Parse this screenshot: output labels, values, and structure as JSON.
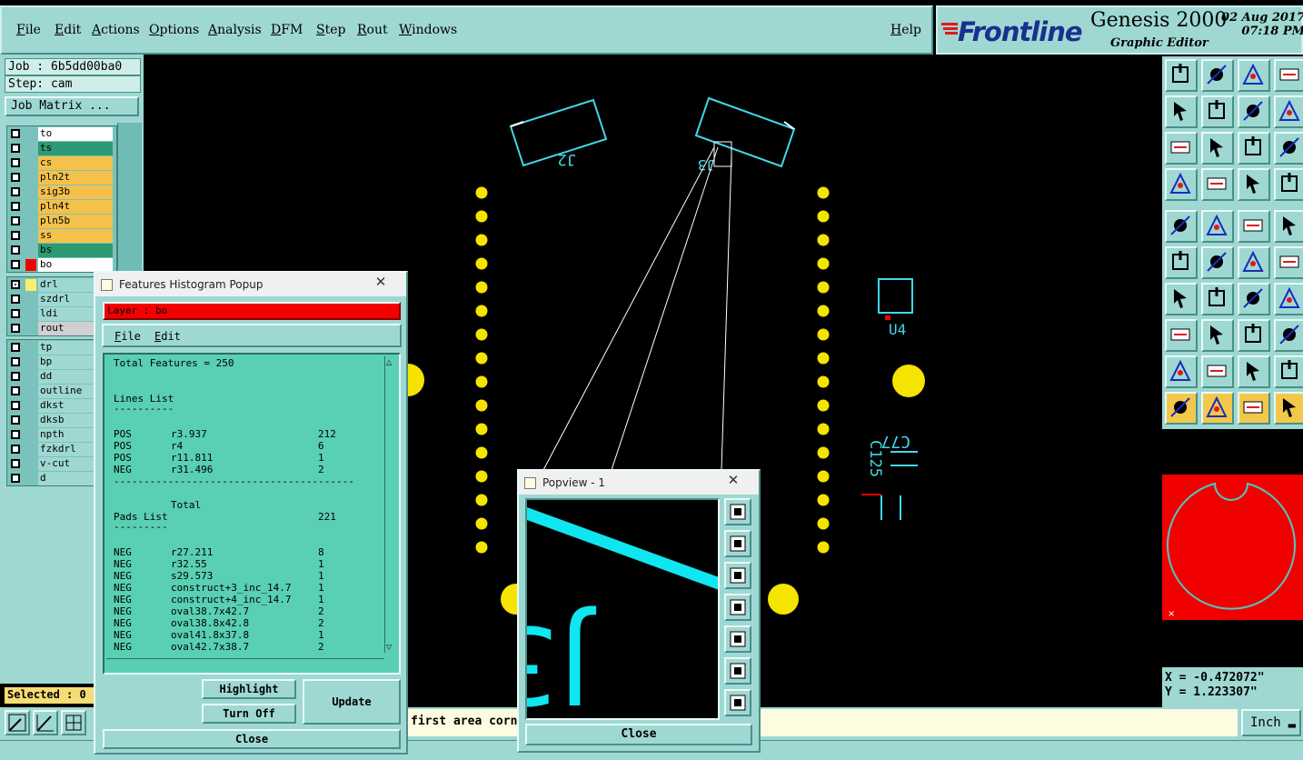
{
  "menu": {
    "items": [
      "File",
      "Edit",
      "Actions",
      "Options",
      "Analysis",
      "DFM",
      "Step",
      "Rout",
      "Windows"
    ],
    "help": "Help"
  },
  "brand": {
    "logo": "Frontline",
    "product": "Genesis 2000",
    "subtitle": "Graphic Editor",
    "date": "02 Aug 2017",
    "time": "07:18 PM"
  },
  "job": {
    "job": "Job : 6b5dd00ba0",
    "step": "Step: cam",
    "matrix_button": "Job Matrix ..."
  },
  "layers_group1": [
    {
      "name": "to",
      "color": "#ffffff"
    },
    {
      "name": "ts",
      "color": "#2c9a73"
    },
    {
      "name": "cs",
      "color": "#f4c24a"
    },
    {
      "name": "pln2t",
      "color": "#f4c24a"
    },
    {
      "name": "sig3b",
      "color": "#f4c24a"
    },
    {
      "name": "pln4t",
      "color": "#f4c24a"
    },
    {
      "name": "pln5b",
      "color": "#f4c24a"
    },
    {
      "name": "ss",
      "color": "#f4c24a"
    },
    {
      "name": "bs",
      "color": "#2c9a73"
    },
    {
      "name": "bo",
      "color": "#ffffff",
      "swatch": "#f20000"
    }
  ],
  "layers_group2": [
    {
      "name": "drl",
      "color": "#9fd8d3",
      "swatch": "#f9f06a",
      "on": true
    },
    {
      "name": "szdrl",
      "color": "#9fd8d3"
    },
    {
      "name": "ldi",
      "color": "#9fd8d3"
    },
    {
      "name": "rout",
      "color": "#d0d0d0"
    }
  ],
  "layers_group3": [
    {
      "name": "tp",
      "color": "#9fd8d3"
    },
    {
      "name": "bp",
      "color": "#9fd8d3"
    },
    {
      "name": "dd",
      "color": "#9fd8d3"
    },
    {
      "name": "outline",
      "color": "#9fd8d3"
    },
    {
      "name": "dkst",
      "color": "#9fd8d3"
    },
    {
      "name": "dksb",
      "color": "#9fd8d3"
    },
    {
      "name": "npth",
      "color": "#9fd8d3"
    },
    {
      "name": "fzkdrl",
      "color": "#9fd8d3"
    },
    {
      "name": "v-cut",
      "color": "#9fd8d3"
    },
    {
      "name": "d",
      "color": "#9fd8d3"
    }
  ],
  "selected": "Selected : 0",
  "prompt": "first area corner",
  "unit": "Inch",
  "status_text": "",
  "coords": {
    "x": "X = -0.472072\"",
    "y": "Y = 1.223307\""
  },
  "board_labels": {
    "j2": "J2",
    "j3": "J3",
    "u4": "U4",
    "c77": "C77",
    "c125": "C125"
  },
  "histogram": {
    "title": "Features Histogram Popup",
    "layer": "Layer :  bo",
    "menu_file": "File",
    "menu_edit": "Edit",
    "total": "Total Features = 250",
    "lines_heading": "Lines List",
    "lines_rule": "----------",
    "lines": [
      {
        "pol": "POS",
        "sym": "r3.937",
        "count": "212"
      },
      {
        "pol": "POS",
        "sym": "r4",
        "count": "6"
      },
      {
        "pol": "POS",
        "sym": "r11.811",
        "count": "1"
      },
      {
        "pol": "NEG",
        "sym": "r31.496",
        "count": "2"
      }
    ],
    "divider": "----------------------------------------",
    "total_label": "Total",
    "total_value": "221",
    "pads_heading": "Pads List",
    "pads_rule": "---------",
    "pads": [
      {
        "pol": "NEG",
        "sym": "r27.211",
        "count": "8"
      },
      {
        "pol": "NEG",
        "sym": "r32.55",
        "count": "1"
      },
      {
        "pol": "NEG",
        "sym": "s29.573",
        "count": "1"
      },
      {
        "pol": "NEG",
        "sym": "construct+3_inc_14.7",
        "count": "1"
      },
      {
        "pol": "NEG",
        "sym": "construct+4_inc_14.7",
        "count": "1"
      },
      {
        "pol": "NEG",
        "sym": "oval38.7x42.7",
        "count": "2"
      },
      {
        "pol": "NEG",
        "sym": "oval38.8x42.8",
        "count": "2"
      },
      {
        "pol": "NEG",
        "sym": "oval41.8x37.8",
        "count": "1"
      },
      {
        "pol": "NEG",
        "sym": "oval42.7x38.7",
        "count": "2"
      }
    ],
    "highlight": "Highlight",
    "turn_off": "Turn Off",
    "update": "Update",
    "close": "Close"
  },
  "popview": {
    "title": "Popview - 1",
    "close": "Close"
  }
}
